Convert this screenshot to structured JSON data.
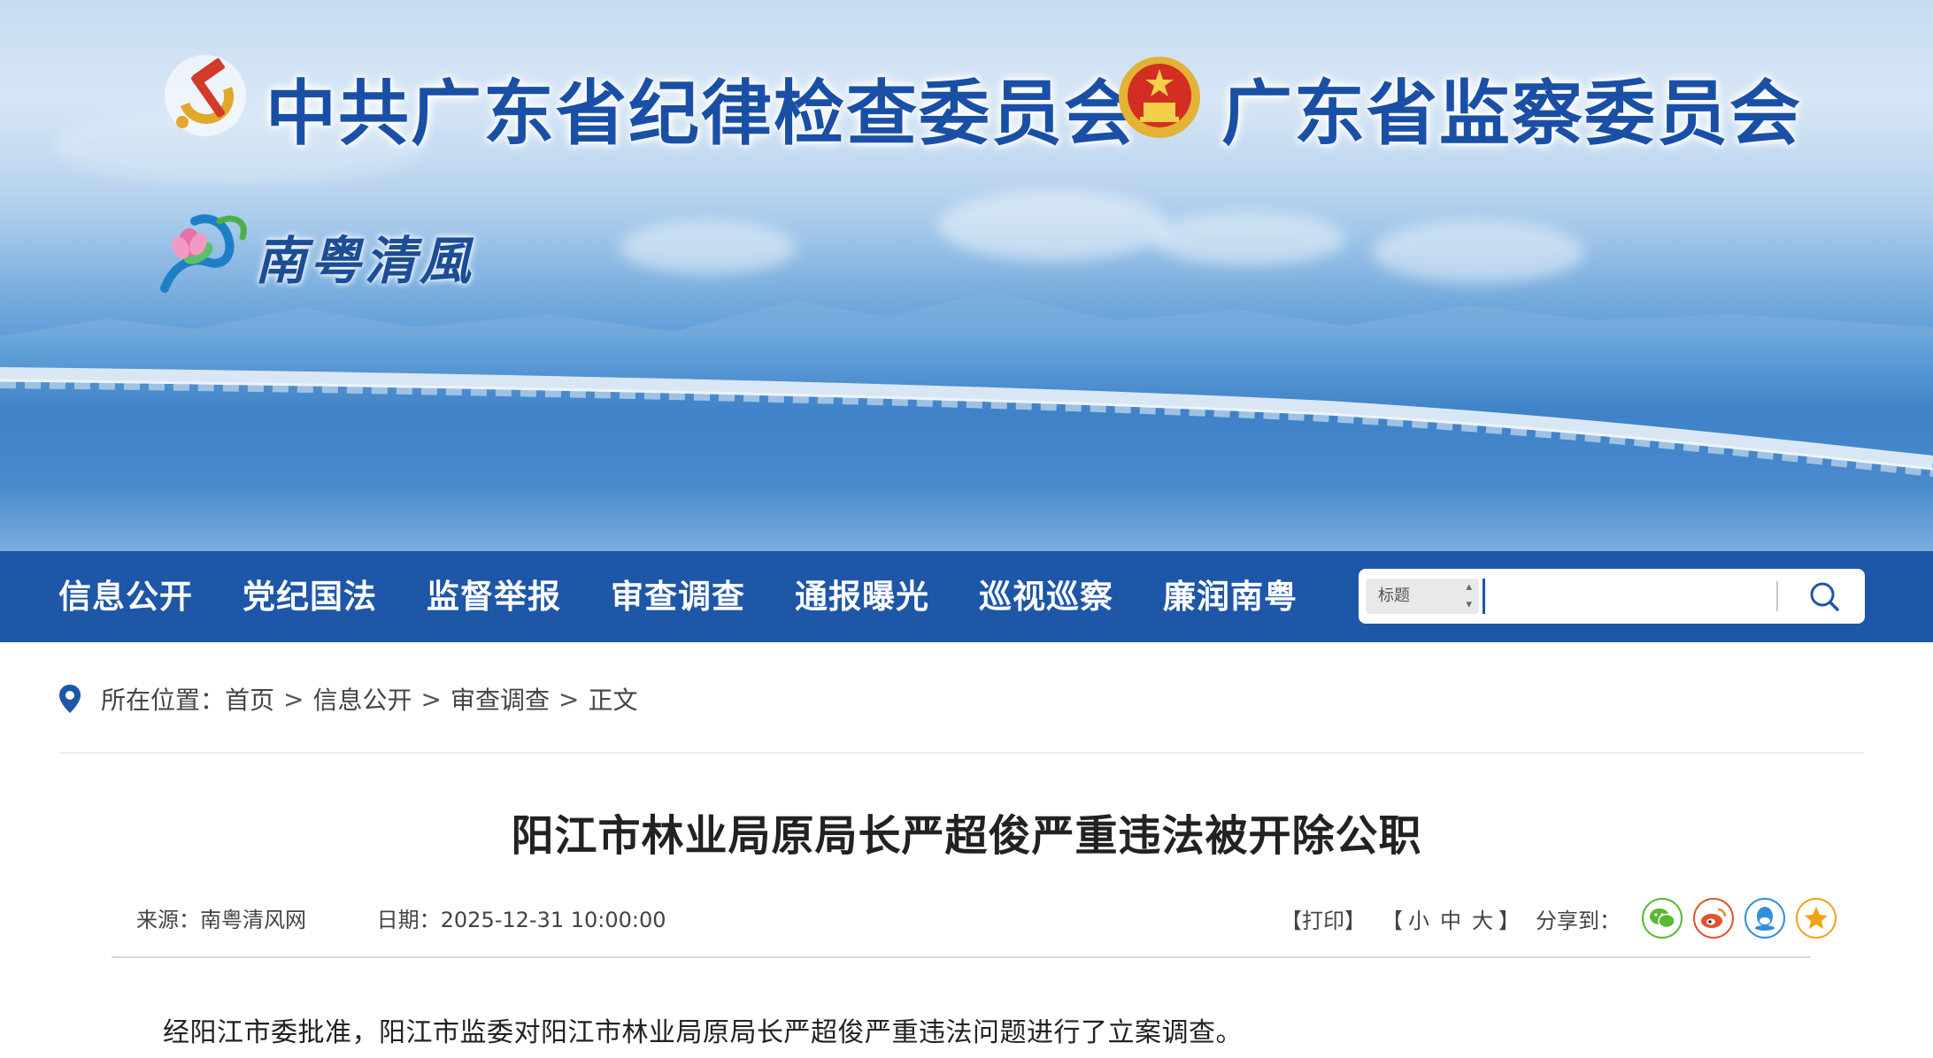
{
  "header": {
    "party_title": "中共广东省纪律检查委员会",
    "state_title": "广东省监察委员会",
    "logo_text": "南粤清風",
    "party_emblem_icon": "hammer-sickle-icon",
    "national_emblem_icon": "national-emblem-icon",
    "logo_icon": "lotus-logo-icon"
  },
  "nav": {
    "items": [
      {
        "label": "信息公开"
      },
      {
        "label": "党纪国法"
      },
      {
        "label": "监督举报"
      },
      {
        "label": "审查调查"
      },
      {
        "label": "通报曝光"
      },
      {
        "label": "巡视巡察"
      },
      {
        "label": "廉润南粤"
      }
    ],
    "search": {
      "field_select": "标题",
      "query": "",
      "icon": "search-icon"
    }
  },
  "breadcrumb": {
    "prefix": "所在位置：",
    "items": [
      "首页",
      "信息公开",
      "审查调查",
      "正文"
    ],
    "separator": ">",
    "icon": "location-pin-icon"
  },
  "article": {
    "title": "阳江市林业局原局长严超俊严重违法被开除公职",
    "source": "来源：南粤清风网",
    "date": "日期：2025-12-31 10:00:00",
    "print_label": "【打印】",
    "size_open": "【",
    "size_small": "小",
    "size_medium": "中",
    "size_large": "大",
    "size_close": "】",
    "share_label": "分享到：",
    "share_icons": [
      "wechat-icon",
      "weibo-icon",
      "qq-icon",
      "qzone-icon"
    ],
    "paragraphs": [
      "经阳江市委批准，阳江市监委对阳江市林业局原局长严超俊严重违法问题进行了立案调查。"
    ]
  },
  "colors": {
    "nav_bg": "#1e56a8",
    "title_blue": "#1a4fa6",
    "wechat": "#5bb833",
    "weibo": "#e2522d",
    "qq": "#2f8ee0",
    "qzone": "#f0a317"
  }
}
